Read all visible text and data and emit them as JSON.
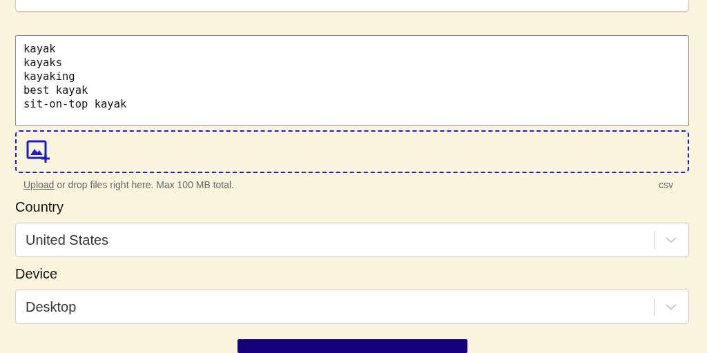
{
  "keywords": {
    "lines": [
      "kayak",
      "kayaks",
      "kayaking",
      "best kayak",
      "sit-on-top kayak"
    ]
  },
  "upload": {
    "link": "Upload",
    "hint": " or drop files right here. Max 100 MB total.",
    "types": "csv"
  },
  "fields": [
    {
      "label": "Country",
      "value": "United States"
    },
    {
      "label": "Device",
      "value": "Desktop"
    }
  ]
}
